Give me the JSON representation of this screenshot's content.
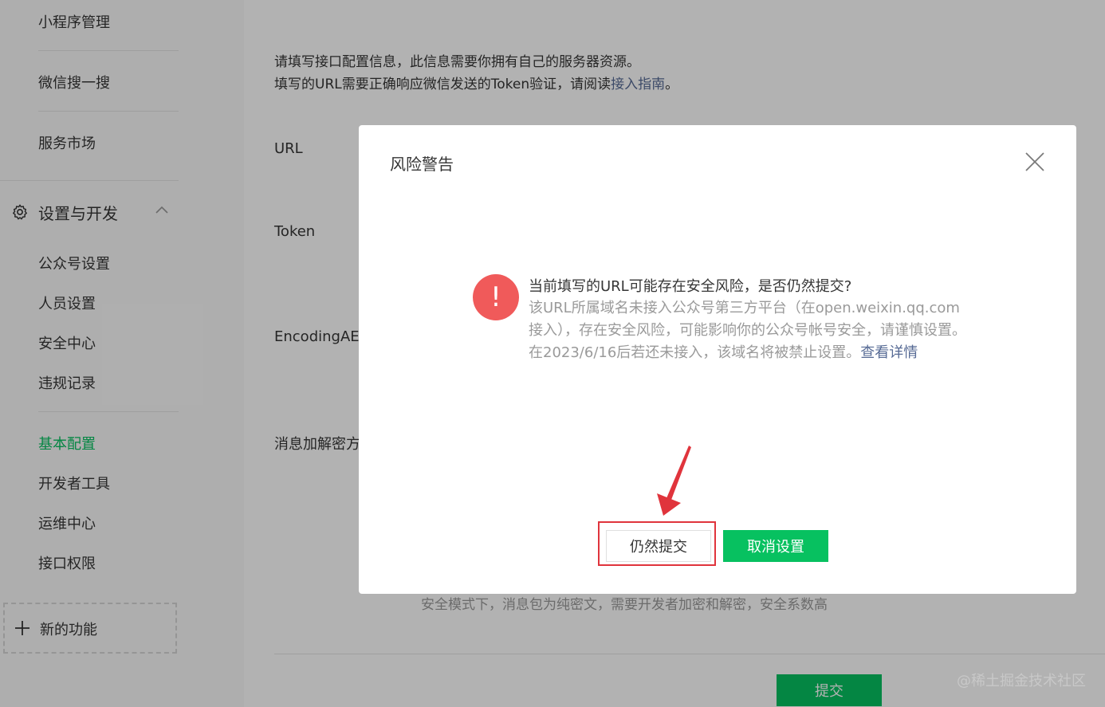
{
  "sidebar": {
    "top_items": [
      "小程序管理",
      "微信搜一搜",
      "服务市场"
    ],
    "section_title": "设置与开发",
    "section_icon": "gear-icon",
    "items_group1": [
      "公众号设置",
      "人员设置",
      "安全中心",
      "违规记录"
    ],
    "items_group2": [
      "基本配置",
      "开发者工具",
      "运维中心",
      "接口权限"
    ],
    "active_item": "基本配置",
    "new_feature": "新的功能"
  },
  "main": {
    "intro_line1": "请填写接口配置信息，此信息需要你拥有自己的服务器资源。",
    "intro_line2_prefix": "填写的URL需要正确响应微信发送的Token验证，请阅读",
    "intro_link": "接入指南",
    "intro_line2_suffix": "。",
    "labels": {
      "url": "URL",
      "token": "Token",
      "aes": "EncodingAES",
      "encrypt": "消息加解密方"
    },
    "hint": "安全模式下，消息包为纯密文，需要开发者加密和解密，安全系数高",
    "submit": "提交"
  },
  "dialog": {
    "title": "风险警告",
    "warn_symbol": "!",
    "message_title": "当前填写的URL可能存在安全风险，是否仍然提交?",
    "message_body": "该URL所属域名未接入公众号第三方平台（在open.weixin.qq.com接入），存在安全风险，可能影响你的公众号帐号安全，请谨慎设置。在2023/6/16后若还未接入，该域名将被禁止设置。",
    "detail_link": "查看详情",
    "btn_submit_anyway": "仍然提交",
    "btn_cancel": "取消设置"
  },
  "watermark": "@稀土掘金技术社区",
  "colors": {
    "primary_green": "#07c160",
    "link_blue": "#576b95",
    "warning_red": "#f05a5a",
    "annotation_red": "#e0343c"
  }
}
